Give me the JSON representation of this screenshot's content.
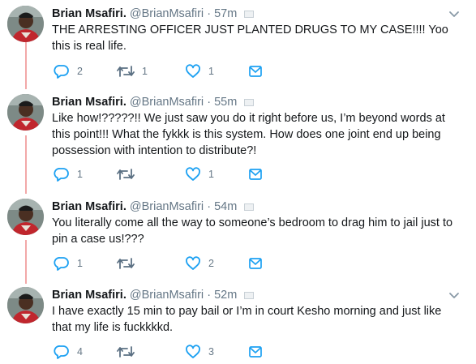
{
  "tweets": [
    {
      "name": "Brian Msafiri.",
      "handle": "@BrianMsafiri",
      "separator": "·",
      "time": "57m",
      "text": "THE ARRESTING OFFICER JUST PLANTED DRUGS TO MY CASE!!!! Yoo this is real life.",
      "replies": "2",
      "retweets": "1",
      "likes": "1"
    },
    {
      "name": "Brian Msafiri.",
      "handle": "@BrianMsafiri",
      "separator": "·",
      "time": "55m",
      "text": "Like how!?????!! We just saw you do it right before us, I’m beyond words at this point!!!  What the fykkk is this system. How does one joint end up being possession with intention to distribute?!",
      "replies": "1",
      "retweets": "",
      "likes": "1"
    },
    {
      "name": "Brian Msafiri.",
      "handle": "@BrianMsafiri",
      "separator": "·",
      "time": "54m",
      "text": "You literally come all the way to someone’s bedroom to drag him to jail just to pin a case us!???",
      "replies": "1",
      "retweets": "",
      "likes": "2"
    },
    {
      "name": "Brian Msafiri.",
      "handle": "@BrianMsafiri",
      "separator": "·",
      "time": "52m",
      "text": "I have exactly 15 min to pay bail or I’m in court Kesho morning and just like that my life is fuckkkkd.",
      "replies": "4",
      "retweets": "",
      "likes": "3"
    }
  ],
  "icons": {
    "reply": "reply-icon",
    "retweet": "retweet-icon",
    "like": "heart-icon",
    "message": "envelope-icon",
    "caret": "chevron-down-icon",
    "avatar": "avatar"
  },
  "colors": {
    "text": "#14171a",
    "muted": "#657786",
    "thread_line": "#f2a8a8",
    "icon": "#657786"
  }
}
